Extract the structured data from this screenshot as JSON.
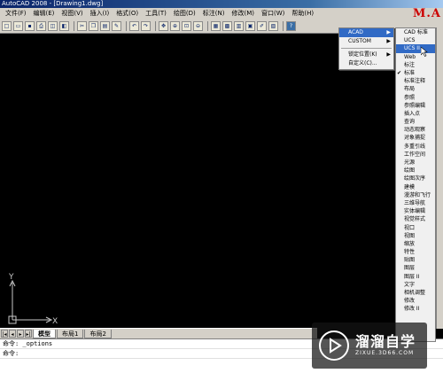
{
  "window": {
    "title": "AutoCAD 2008 - [Drawing1.dwg]",
    "logo": "M.A"
  },
  "menubar": [
    "文件(F)",
    "编辑(E)",
    "视图(V)",
    "插入(I)",
    "格式(O)",
    "工具(T)",
    "绘图(D)",
    "标注(N)",
    "修改(M)",
    "窗口(W)",
    "帮助(H)"
  ],
  "toolbar": {
    "icons": [
      "new-icon",
      "open-icon",
      "save-icon",
      "print-icon",
      "preview-icon",
      "publish-icon",
      "cut-icon",
      "copy-icon",
      "paste-icon",
      "matchprop-icon",
      "undo-icon",
      "redo-icon",
      "pan-icon",
      "zoom-realtime-icon",
      "zoom-window-icon",
      "zoom-previous-icon",
      "properties-icon",
      "designcenter-icon",
      "toolpalettes-icon",
      "sheetset-icon",
      "markup-icon",
      "calculator-icon",
      "help-icon"
    ]
  },
  "ucs_icon": {
    "y_label": "Y",
    "x_label": "X"
  },
  "tabs": {
    "model": "模型",
    "layout1": "布局1",
    "layout2": "布局2"
  },
  "command": {
    "line1": "命令: _options",
    "line2": "命令:"
  },
  "context_menu_1": {
    "items": [
      {
        "label": "ACAD",
        "submenu": true,
        "highlighted": true
      },
      {
        "label": "CUSTOM",
        "submenu": true,
        "highlighted": false
      }
    ],
    "items2": [
      {
        "label": "锁定位置(K)",
        "submenu": true
      },
      {
        "label": "自定义(C)...",
        "submenu": false
      }
    ]
  },
  "context_menu_2": {
    "items": [
      {
        "label": "CAD 标准",
        "checked": false,
        "highlighted": false
      },
      {
        "label": "UCS",
        "checked": false,
        "highlighted": false
      },
      {
        "label": "UCS II",
        "checked": false,
        "highlighted": true
      },
      {
        "label": "Web",
        "checked": false,
        "highlighted": false
      },
      {
        "label": "标注",
        "checked": false,
        "highlighted": false
      },
      {
        "label": "标准",
        "checked": true,
        "highlighted": false
      },
      {
        "label": "标准注释",
        "checked": false,
        "highlighted": false
      },
      {
        "label": "布局",
        "checked": false,
        "highlighted": false
      },
      {
        "label": "参照",
        "checked": false,
        "highlighted": false
      },
      {
        "label": "参照编辑",
        "checked": false,
        "highlighted": false
      },
      {
        "label": "插入点",
        "checked": false,
        "highlighted": false
      },
      {
        "label": "查询",
        "checked": false,
        "highlighted": false
      },
      {
        "label": "动态观察",
        "checked": false,
        "highlighted": false
      },
      {
        "label": "对象捕捉",
        "checked": false,
        "highlighted": false
      },
      {
        "label": "多重引线",
        "checked": false,
        "highlighted": false
      },
      {
        "label": "工作空间",
        "checked": false,
        "highlighted": false
      },
      {
        "label": "光源",
        "checked": false,
        "highlighted": false
      },
      {
        "label": "绘图",
        "checked": false,
        "highlighted": false
      },
      {
        "label": "绘图次序",
        "checked": false,
        "highlighted": false
      },
      {
        "label": "建模",
        "checked": false,
        "highlighted": false
      },
      {
        "label": "漫游和飞行",
        "checked": false,
        "highlighted": false
      },
      {
        "label": "三维导航",
        "checked": false,
        "highlighted": false
      },
      {
        "label": "实体编辑",
        "checked": false,
        "highlighted": false
      },
      {
        "label": "视觉样式",
        "checked": false,
        "highlighted": false
      },
      {
        "label": "视口",
        "checked": false,
        "highlighted": false
      },
      {
        "label": "视图",
        "checked": false,
        "highlighted": false
      },
      {
        "label": "缩放",
        "checked": false,
        "highlighted": false
      },
      {
        "label": "特性",
        "checked": false,
        "highlighted": false
      },
      {
        "label": "贴图",
        "checked": false,
        "highlighted": false
      },
      {
        "label": "图层",
        "checked": false,
        "highlighted": false
      },
      {
        "label": "图层 II",
        "checked": false,
        "highlighted": false
      },
      {
        "label": "文字",
        "checked": false,
        "highlighted": false
      },
      {
        "label": "相机调整",
        "checked": false,
        "highlighted": false
      },
      {
        "label": "修改",
        "checked": false,
        "highlighted": false
      },
      {
        "label": "修改 II",
        "checked": false,
        "highlighted": false
      }
    ]
  },
  "watermark": {
    "name": "溜溜自学",
    "url": "ZIXUE.3D66.COM"
  },
  "colors": {
    "highlight": "#316ac5",
    "title_bar": "#0a246a",
    "logo_red": "#cc0000"
  }
}
